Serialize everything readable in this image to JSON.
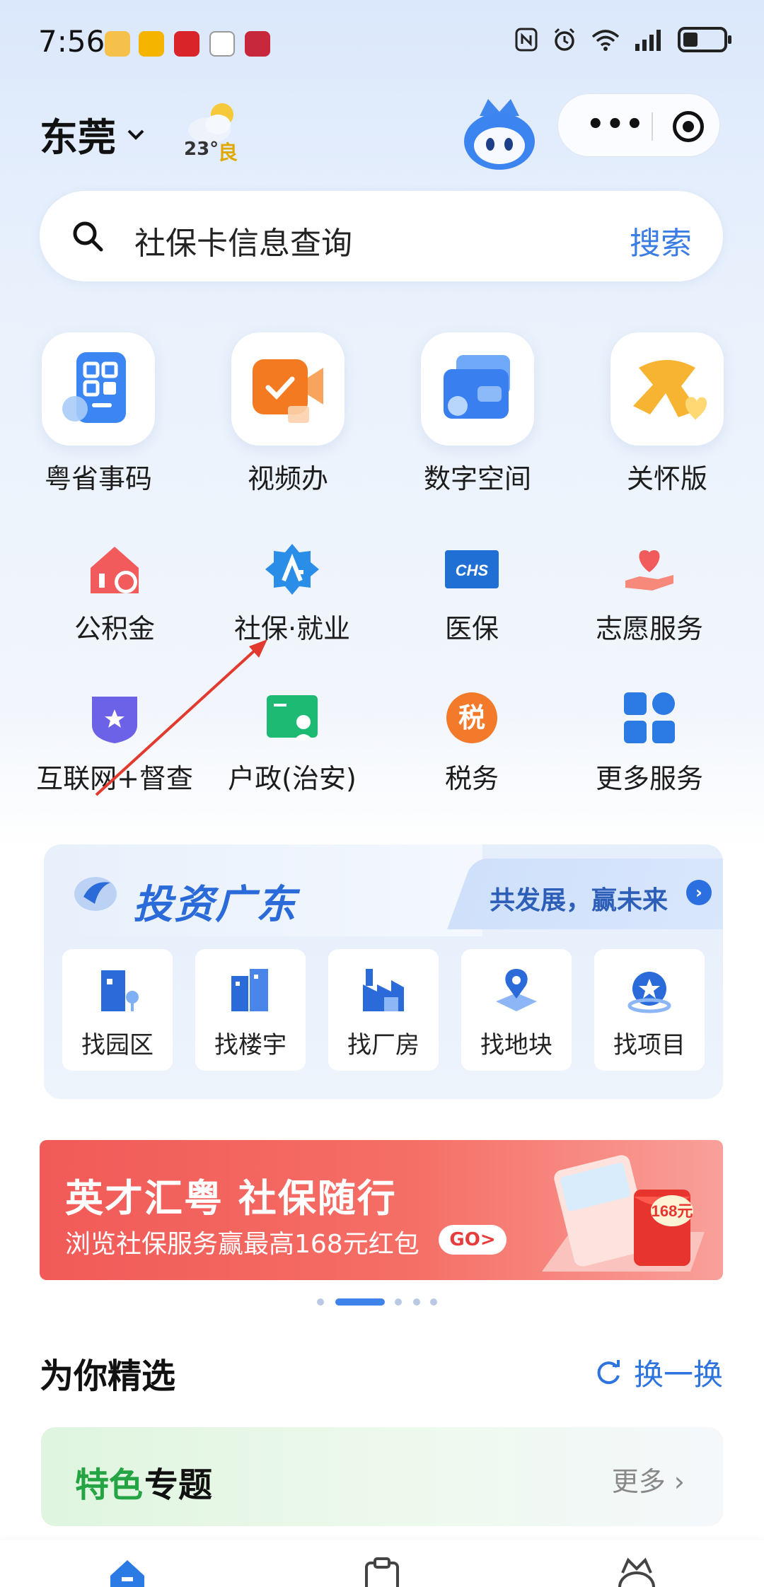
{
  "status_bar": {
    "time": "7:56"
  },
  "header": {
    "city": "东莞",
    "weather_temp": "23°",
    "weather_aq": "良"
  },
  "search": {
    "placeholder_text": "社保卡信息查询",
    "button": "搜索"
  },
  "tiles": [
    {
      "label": "粤省事码"
    },
    {
      "label": "视频办"
    },
    {
      "label": "数字空间"
    },
    {
      "label": "关怀版"
    }
  ],
  "services_row1": [
    {
      "label": "公积金"
    },
    {
      "label": "社保·就业"
    },
    {
      "label": "医保",
      "icon_text": "CHS"
    },
    {
      "label": "志愿服务"
    }
  ],
  "services_row2": [
    {
      "label": "互联网+督查"
    },
    {
      "label": "户政(治安)"
    },
    {
      "label": "税务",
      "icon_text": "税"
    },
    {
      "label": "更多服务"
    }
  ],
  "invest": {
    "title": "投资广东",
    "slogan": "共发展，赢未来",
    "items": [
      {
        "label": "找园区"
      },
      {
        "label": "找楼宇"
      },
      {
        "label": "找厂房"
      },
      {
        "label": "找地块"
      },
      {
        "label": "找项目"
      }
    ]
  },
  "banner": {
    "title": "英才汇粤 社保随行",
    "subtitle": "浏览社保服务赢最高168元红包",
    "go": "GO>",
    "amount": "168元"
  },
  "picks": {
    "title": "为你精选",
    "refresh": "换一换",
    "card_title_green": "特色",
    "card_title_dark": "专题",
    "more": "更多 ›"
  },
  "colors": {
    "accent": "#3b7de3",
    "banner_red": "#f15a58",
    "green": "#24a443",
    "annotation_arrow": "#e23a2e"
  }
}
